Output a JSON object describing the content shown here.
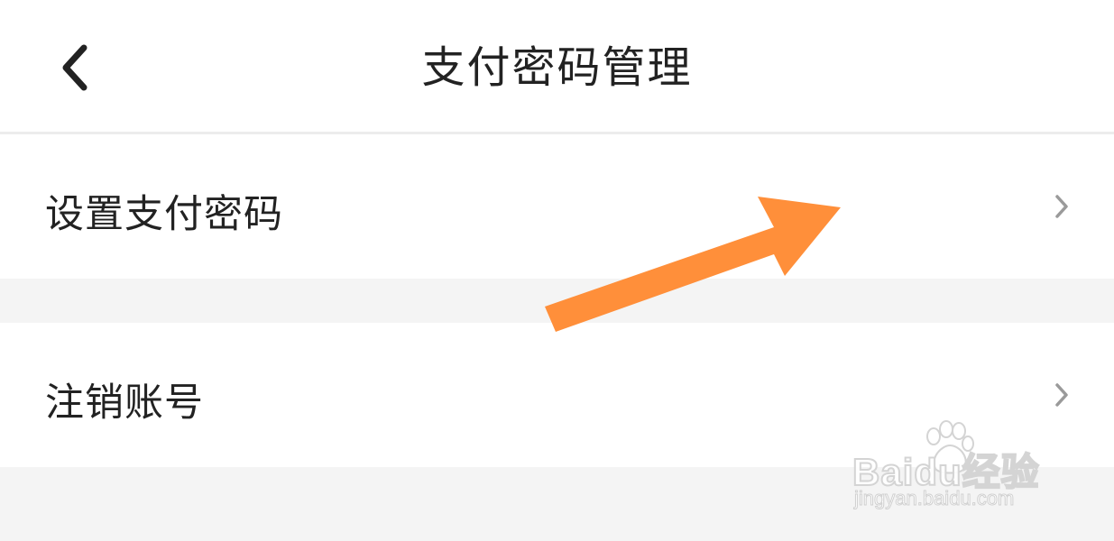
{
  "header": {
    "title": "支付密码管理",
    "back_icon": "chevron-left-icon"
  },
  "menu": [
    {
      "label": "设置支付密码",
      "icon": "chevron-right-icon"
    },
    {
      "label": "注销账号",
      "icon": "chevron-right-icon"
    }
  ],
  "annotation": {
    "arrow_color": "#ff8f3a"
  },
  "watermark": {
    "logo": "Baidu经验",
    "url": "jingyan.baidu.com"
  },
  "colors": {
    "background": "#f4f4f4",
    "surface": "#ffffff",
    "text": "#222222",
    "chevron": "#9a9a9a"
  }
}
